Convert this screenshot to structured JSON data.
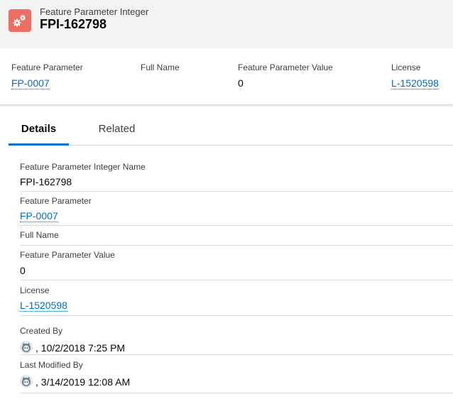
{
  "header": {
    "object_type": "Feature Parameter Integer",
    "record_name": "FPI-162798",
    "icon": "gears-icon",
    "icon_color": "#ef6e64"
  },
  "highlights": [
    {
      "label": "Feature Parameter",
      "value": "FP-0007",
      "is_link": true
    },
    {
      "label": "Full Name",
      "value": "",
      "is_link": false
    },
    {
      "label": "Feature Parameter Value",
      "value": "0",
      "is_link": false
    },
    {
      "label": "License",
      "value": "L-1520598",
      "is_link": true
    }
  ],
  "tabs": [
    {
      "label": "Details",
      "active": true
    },
    {
      "label": "Related",
      "active": false
    }
  ],
  "details": {
    "name": {
      "label": "Feature Parameter Integer Name",
      "value": "FPI-162798"
    },
    "feature_parameter": {
      "label": "Feature Parameter",
      "value": "FP-0007"
    },
    "full_name": {
      "label": "Full Name",
      "value": ""
    },
    "feature_parameter_value": {
      "label": "Feature Parameter Value",
      "value": "0"
    },
    "license": {
      "label": "License",
      "value": "L-1520598"
    },
    "created_by": {
      "label": "Created By",
      "value": ", 10/2/2018 7:25 PM",
      "avatar_icon": "user-avatar-icon"
    },
    "last_modified_by": {
      "label": "Last Modified By",
      "value": ", 3/14/2019 12:08 AM",
      "avatar_icon": "user-avatar-icon"
    }
  },
  "colors": {
    "link": "#006dcc",
    "tab_active_underline": "#0070d2",
    "header_bg": "#f3f3f3"
  }
}
